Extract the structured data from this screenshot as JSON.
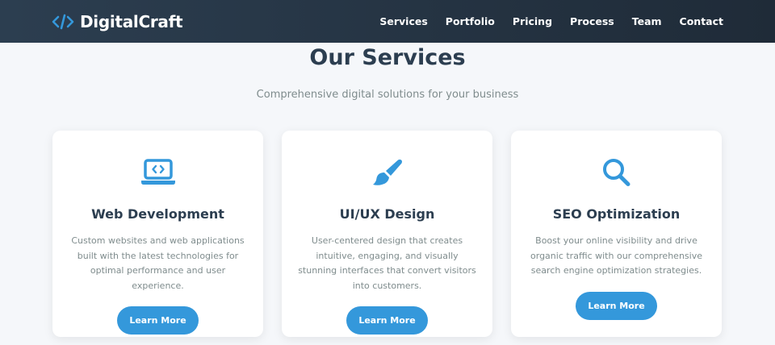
{
  "brand": {
    "name": "DigitalCraft",
    "icon": "code-icon",
    "accent": "#3498db"
  },
  "nav": {
    "items": [
      {
        "label": "Services"
      },
      {
        "label": "Portfolio"
      },
      {
        "label": "Pricing"
      },
      {
        "label": "Process"
      },
      {
        "label": "Team"
      },
      {
        "label": "Contact"
      }
    ]
  },
  "services": {
    "title": "Our Services",
    "subtitle": "Comprehensive digital solutions for your business",
    "cards": [
      {
        "icon": "laptop-code-icon",
        "title": "Web Development",
        "description": "Custom websites and web applications built with the latest technologies for optimal performance and user experience.",
        "button": "Learn More"
      },
      {
        "icon": "paintbrush-icon",
        "title": "UI/UX Design",
        "description": "User-centered design that creates intuitive, engaging, and visually stunning interfaces that convert visitors into customers.",
        "button": "Learn More"
      },
      {
        "icon": "search-icon",
        "title": "SEO Optimization",
        "description": "Boost your online visibility and drive organic traffic with our comprehensive search engine optimization strategies.",
        "button": "Learn More"
      }
    ]
  },
  "colors": {
    "navbar": "#2c3e50",
    "background": "#f5f7fa",
    "heading": "#2c3e50",
    "muted": "#7f8c8d",
    "accent": "#3498db"
  }
}
